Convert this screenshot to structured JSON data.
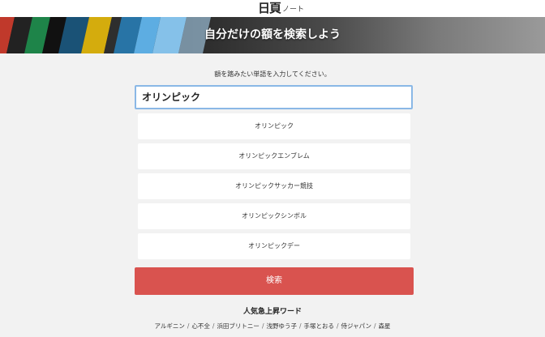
{
  "header": {
    "logo_mark": "日頁",
    "logo_sub": "ノート"
  },
  "banner": {
    "title": "自分だけの額を検索しよう"
  },
  "search": {
    "prompt": "額を踏みたい単語を入力してください。",
    "value": "オリンピック",
    "button_label": "検索",
    "suggestions": [
      "オリンピック",
      "オリンピックエンブレム",
      "オリンピックサッカー競技",
      "オリンピックシンボル",
      "オリンピックデー"
    ]
  },
  "trending": {
    "title": "人気急上昇ワード",
    "items": [
      "アルギニン",
      "心不全",
      "浜田ブリトニー",
      "浅野ゆう子",
      "手塚とおる",
      "侍ジャパン",
      "森星"
    ],
    "separator": "/"
  },
  "colors": {
    "accent_button": "#d9534f",
    "input_focus_border": "#8ab8e6",
    "page_background": "#f2f2f2"
  }
}
